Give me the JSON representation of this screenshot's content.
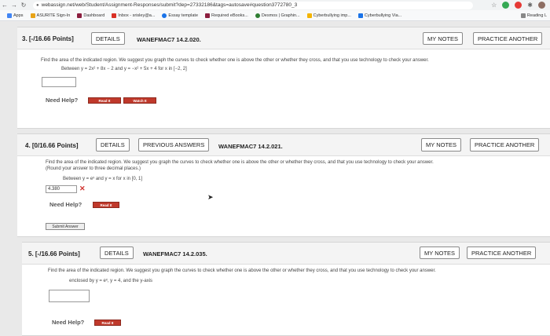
{
  "browser": {
    "url": "webassign.net/web/Student/Assignment-Responses/submit?dep=27332186&tags=autosave#question3772780_3"
  },
  "bookmarks": [
    {
      "label": "Apps",
      "color": "#4285f4"
    },
    {
      "label": "ASURITE Sign-In",
      "color": "#e8a317"
    },
    {
      "label": "Dashboard",
      "color": "#8b1e3f"
    },
    {
      "label": "Inbox - srisley@a...",
      "color": "#d93025"
    },
    {
      "label": "Essay template",
      "color": "#1a73e8"
    },
    {
      "label": "Required eBooks...",
      "color": "#8b1e3f"
    },
    {
      "label": "Desmos | Graphin...",
      "color": "#2e7d32"
    },
    {
      "label": "Cyberbullying imp...",
      "color": "#f4b400"
    },
    {
      "label": "Cyberbullying Via...",
      "color": "#1a73e8"
    }
  ],
  "bookmarks_right": "Reading L",
  "questions": [
    {
      "points": "3. [-/16.66 Points]",
      "details": "DETAILS",
      "code": "WANEFMAC7 14.2.020.",
      "my_notes": "MY NOTES",
      "practice": "PRACTICE ANOTHER",
      "text": "Find the area of the indicated region. We suggest you graph the curves to check whether one is above the other or whether they cross, and that you use technology to check your answer.",
      "sub": "Between y = 2x² + 8x − 2 and y = −x² + 5x + 4 for x in [−2, 2]",
      "need_help": "Need Help?",
      "read_it": "Read It",
      "watch_it": "Watch It"
    },
    {
      "points": "4. [0/16.66 Points]",
      "details": "DETAILS",
      "prev": "PREVIOUS ANSWERS",
      "code": "WANEFMAC7 14.2.021.",
      "my_notes": "MY NOTES",
      "practice": "PRACTICE ANOTHER",
      "text": "Find the area of the indicated region. We suggest you graph the curves to check whether one is above the other or whether they cross, and that you use technology to check your answer.",
      "text2": "(Round your answer to three decimal places.)",
      "sub": "Between y = eˣ and y = x for x in [0, 1]",
      "answer": "4.380",
      "need_help": "Need Help?",
      "read_it": "Read It",
      "submit": "Submit Answer"
    },
    {
      "points": "5. [-/16.66 Points]",
      "details": "DETAILS",
      "code": "WANEFMAC7 14.2.035.",
      "my_notes": "MY NOTES",
      "practice": "PRACTICE ANOTHER",
      "text": "Find the area of the indicated region. We suggest you graph the curves to check whether one is above the other or whether they cross, and that you use technology to check your answer.",
      "sub": "enclosed by y = eˣ, y = 4, and the y-axis",
      "need_help": "Need Help?",
      "read_it": "Read It"
    }
  ]
}
